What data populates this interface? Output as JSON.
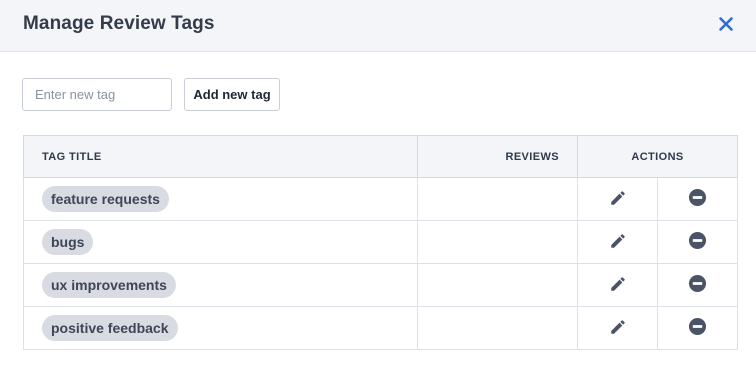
{
  "modal": {
    "title": "Manage Review Tags",
    "close_icon": "close-icon",
    "accent_color": "#2f6bd8"
  },
  "new_tag": {
    "placeholder": "Enter new tag",
    "value": "",
    "button_label": "Add new tag"
  },
  "table": {
    "headers": {
      "tag_title": "TAG TITLE",
      "reviews": "REVIEWS",
      "actions": "ACTIONS"
    },
    "rows": [
      {
        "tag": "feature requests",
        "reviews": ""
      },
      {
        "tag": "bugs",
        "reviews": ""
      },
      {
        "tag": "ux improvements",
        "reviews": ""
      },
      {
        "tag": "positive feedback",
        "reviews": ""
      }
    ],
    "row_actions": {
      "edit_icon": "pencil-icon",
      "delete_icon": "remove-circle-icon"
    },
    "tag_pill_color": "#d9dbe3",
    "icon_color": "#4b5466"
  }
}
